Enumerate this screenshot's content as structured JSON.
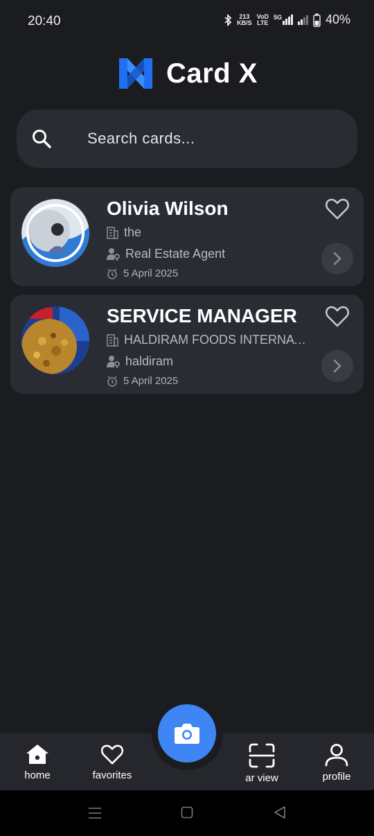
{
  "status_bar": {
    "time": "20:40",
    "net_speed_top": "213",
    "net_speed_bottom": "KB/S",
    "volte_top": "VoD",
    "volte_bottom": "LTE",
    "network": "5G",
    "battery": "40%"
  },
  "header": {
    "title": "Card X"
  },
  "search": {
    "placeholder": "Search cards..."
  },
  "cards": [
    {
      "name": "Olivia Wilson",
      "company": "the",
      "role": "Real Estate Agent",
      "date": "5 April 2025",
      "favorite": false
    },
    {
      "name": "SERVICE MANAGER",
      "company": "HALDIRAM FOODS INTERNATIONAL",
      "role": "haldiram",
      "date": "5 April 2025",
      "favorite": false
    }
  ],
  "bottom_nav": {
    "items": [
      {
        "label": "home",
        "icon": "home-icon",
        "active": true
      },
      {
        "label": "favorites",
        "icon": "heart-icon",
        "active": false
      },
      {
        "label": "ar view",
        "icon": "scan-frame-icon",
        "active": false
      },
      {
        "label": "profile",
        "icon": "person-icon",
        "active": false
      }
    ],
    "fab_icon": "camera-icon"
  },
  "colors": {
    "background": "#1b1c20",
    "card": "#2a2c34",
    "accent": "#3d86f3",
    "logo_blue": "#1f6ff0"
  }
}
